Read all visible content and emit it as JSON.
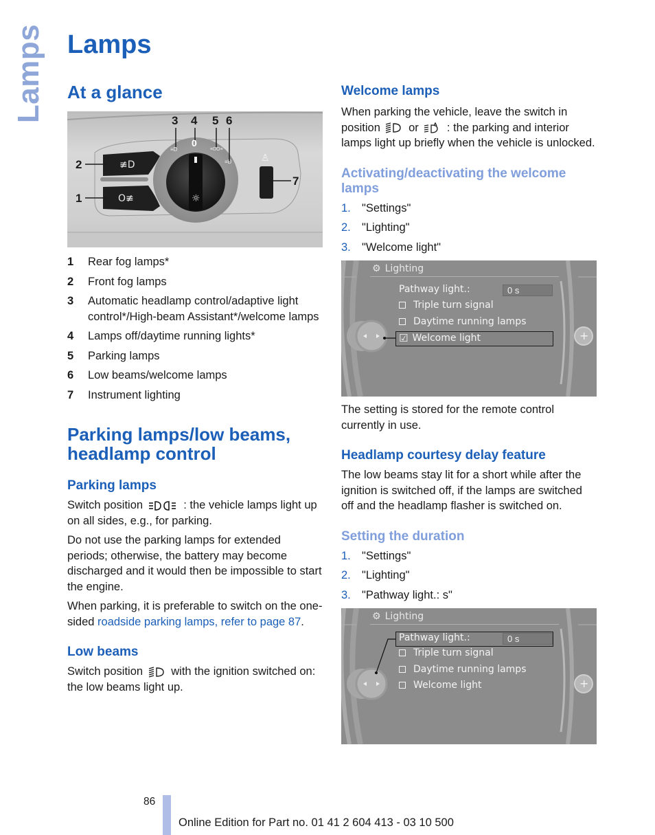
{
  "side_tab": "Lamps",
  "page_title": "Lamps",
  "left": {
    "at_a_glance": {
      "heading": "At a glance",
      "figure_callouts": [
        "1",
        "2",
        "3",
        "4",
        "5",
        "6",
        "7"
      ],
      "dial_zero_label": "0",
      "legend": [
        {
          "num": "1",
          "text": "Rear fog lamps*"
        },
        {
          "num": "2",
          "text": "Front fog lamps"
        },
        {
          "num": "3",
          "text": "Automatic headlamp control/adaptive light control*/High-beam Assistant*/welcome lamps"
        },
        {
          "num": "4",
          "text": "Lamps off/daytime running lights*"
        },
        {
          "num": "5",
          "text": "Parking lamps"
        },
        {
          "num": "6",
          "text": "Low beams/welcome lamps"
        },
        {
          "num": "7",
          "text": "Instrument lighting"
        }
      ]
    },
    "parking_section": {
      "heading": "Parking lamps/low beams, headlamp control",
      "parking_lamps": {
        "heading": "Parking lamps",
        "p1_before": "Switch position",
        "p1_icon": "parking-lamps-icon",
        "p1_after": ": the vehicle lamps light up on all sides, e.g., for parking.",
        "p2": "Do not use the parking lamps for extended periods; otherwise, the battery may become discharged and it would then be impossible to start the engine.",
        "p3_before": "When parking, it is preferable to switch on the one-sided ",
        "p3_link": "roadside parking lamps, refer to page 87",
        "p3_after": "."
      },
      "low_beams": {
        "heading": "Low beams",
        "p1_before": "Switch position",
        "p1_icon": "low-beam-icon",
        "p1_after": "with the ignition switched on: the low beams light up."
      }
    }
  },
  "right": {
    "welcome_lamps": {
      "heading": "Welcome lamps",
      "p1_before": "When parking the vehicle, leave the switch in position",
      "p1_or": "or",
      "p1_after": ": the parking and interior lamps light up briefly when the vehicle is unlocked.",
      "sub_heading": "Activating/deactivating the welcome lamps",
      "steps": [
        {
          "num": "1.",
          "text": "\"Settings\""
        },
        {
          "num": "2.",
          "text": "\"Lighting\""
        },
        {
          "num": "3.",
          "text": "\"Welcome light\""
        }
      ],
      "screen": {
        "title": "Lighting",
        "pathway_label": "Pathway light.:",
        "pathway_value": "0 s",
        "options": [
          {
            "label": "Triple turn signal",
            "checked": false
          },
          {
            "label": "Daytime running lamps",
            "checked": false
          },
          {
            "label": "Welcome light",
            "checked": true
          }
        ],
        "selected": "Welcome light"
      },
      "note": "The setting is stored for the remote control currently in use."
    },
    "courtesy_delay": {
      "heading": "Headlamp courtesy delay feature",
      "p1": "The low beams stay lit for a short while after the ignition is switched off, if the lamps are switched off and the headlamp flasher is switched on.",
      "sub_heading": "Setting the duration",
      "steps": [
        {
          "num": "1.",
          "text": "\"Settings\""
        },
        {
          "num": "2.",
          "text": "\"Lighting\""
        },
        {
          "num": "3.",
          "text": "\"Pathway light.: s\""
        }
      ],
      "screen": {
        "title": "Lighting",
        "pathway_label": "Pathway light.:",
        "pathway_value": "0 s",
        "options": [
          {
            "label": "Triple turn signal",
            "checked": false
          },
          {
            "label": "Daytime running lamps",
            "checked": false
          },
          {
            "label": "Welcome light",
            "checked": false
          }
        ],
        "selected": "Pathway light.:"
      }
    }
  },
  "footer": {
    "page_number": "86",
    "edition": "Online Edition for Part no. 01 41 2 604 413 - 03 10 500"
  },
  "colors": {
    "heading_blue": "#1c5fb8",
    "subheading_light_blue": "#7f9edb",
    "side_tab": "#8fa6d9",
    "footer_bar": "#b0bde6",
    "screen_gray": "#8c8c8c"
  }
}
